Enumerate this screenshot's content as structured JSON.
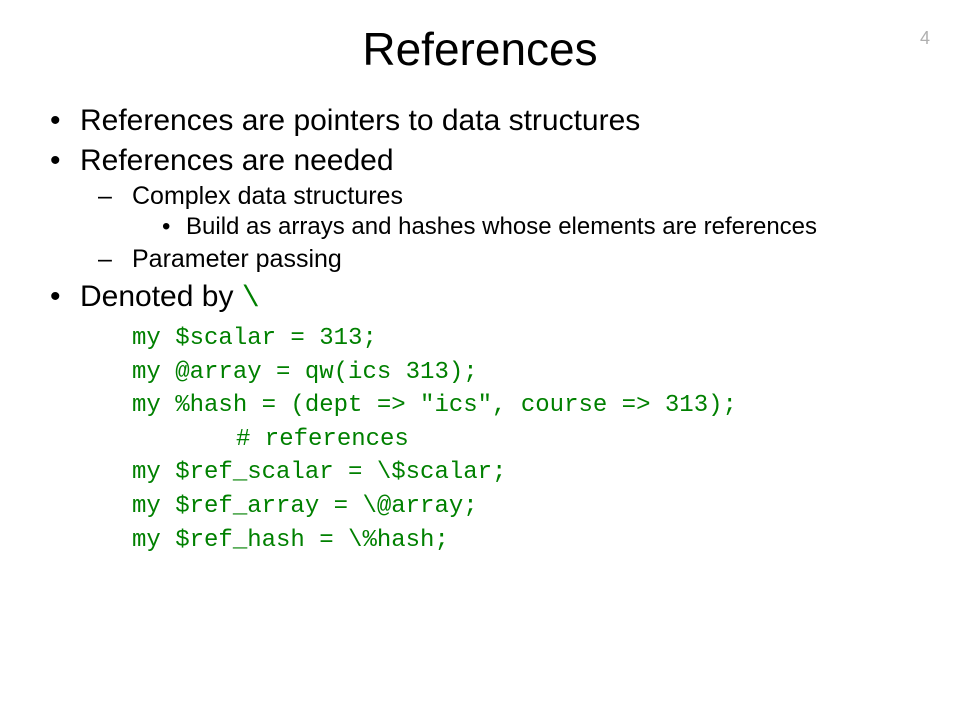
{
  "page_number": "4",
  "title": "References",
  "bullets": {
    "b1": "References are pointers to data structures",
    "b2": "References are needed",
    "b2_1": "Complex data structures",
    "b2_1_1": "Build as arrays and hashes whose elements are references",
    "b2_2": "Parameter passing",
    "b3_prefix": "Denoted by ",
    "b3_symbol": "\\"
  },
  "code": {
    "l1": "my $scalar = 313;",
    "l2": "my @array = qw(ics 313);",
    "l3": "my %hash = (dept => \"ics\", course => 313);",
    "l4": "# references",
    "l5": "my $ref_scalar = \\$scalar;",
    "l6": "my $ref_array = \\@array;",
    "l7": "my $ref_hash = \\%hash;"
  }
}
